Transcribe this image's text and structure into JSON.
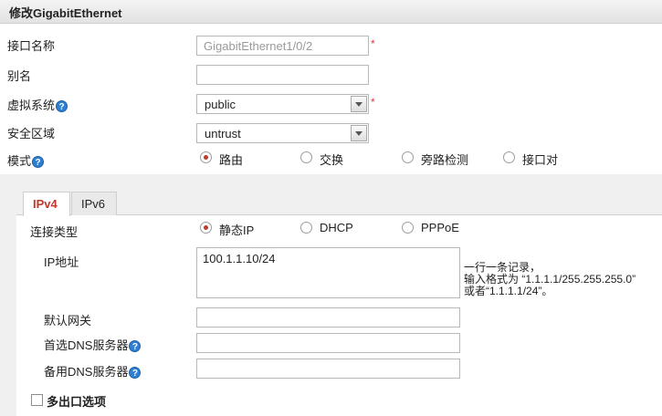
{
  "title": "修改GigabitEthernet",
  "fields": {
    "interface_name": {
      "label": "接口名称",
      "value": "GigabitEthernet1/0/2",
      "required": "*"
    },
    "alias": {
      "label": "别名",
      "value": ""
    },
    "virtual_system": {
      "label": "虚拟系统",
      "value": "public",
      "required": "*",
      "help": "?"
    },
    "security_zone": {
      "label": "安全区域",
      "value": "untrust"
    },
    "mode": {
      "label": "模式",
      "help": "?",
      "options": [
        "路由",
        "交换",
        "旁路检测",
        "接口对"
      ],
      "selected": "路由"
    }
  },
  "tabs": [
    {
      "label": "IPv4"
    },
    {
      "label": "IPv6"
    }
  ],
  "ipv4": {
    "connection_type": {
      "label": "连接类型",
      "options": [
        "静态IP",
        "DHCP",
        "PPPoE"
      ],
      "selected": "静态IP"
    },
    "ip_address": {
      "label": "IP地址",
      "value": "100.1.1.10/24",
      "hint": [
        "一行一条记录，",
        "输入格式为 “1.1.1.1/255.255.255.0”",
        "或者“1.1.1.1/24”。"
      ]
    },
    "default_gateway": {
      "label": "默认网关",
      "value": ""
    },
    "primary_dns": {
      "label": "首选DNS服务器",
      "value": "",
      "help": "?"
    },
    "secondary_dns": {
      "label": "备用DNS服务器",
      "value": "",
      "help": "?"
    },
    "multi_egress": {
      "label": "多出口选项",
      "checked": false
    }
  }
}
